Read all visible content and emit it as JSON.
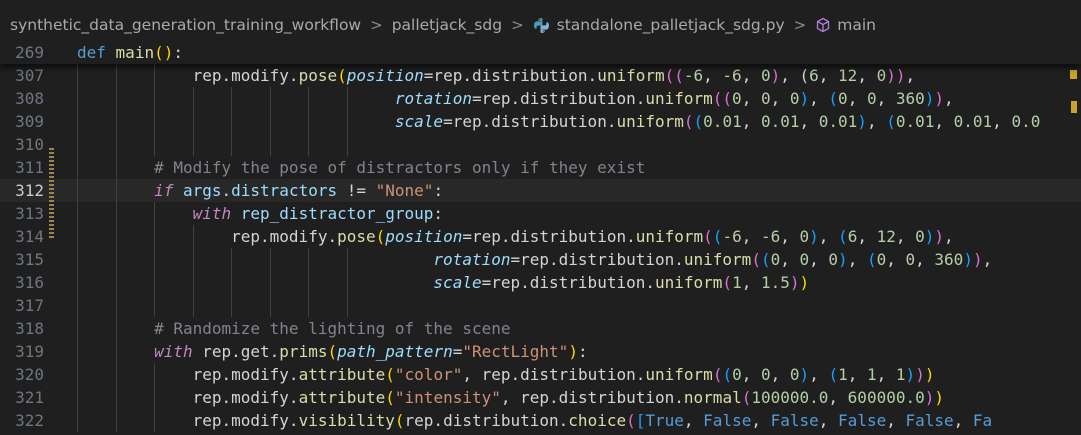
{
  "breadcrumb": {
    "folder": "synthetic_data_generation_training_workflow",
    "subfolder": "palletjack_sdg",
    "file": "standalone_palletjack_sdg.py",
    "symbol": "main",
    "separator": ">"
  },
  "editor": {
    "current_line": "312",
    "lines": [
      {
        "num": "269",
        "tokens": [
          [
            "kw",
            "def"
          ],
          [
            "op",
            " "
          ],
          [
            "fn",
            "main"
          ],
          [
            "p1",
            "("
          ],
          [
            "p1",
            ")"
          ],
          [
            "op",
            ":"
          ]
        ]
      },
      {
        "num": "307",
        "tokens": [
          [
            "op",
            "            rep.modify."
          ],
          [
            "fn",
            "pose"
          ],
          [
            "p1",
            "("
          ],
          [
            "param",
            "position"
          ],
          [
            "op",
            "=rep.distribution."
          ],
          [
            "fn",
            "uniform"
          ],
          [
            "p2",
            "(("
          ],
          [
            "num",
            "-6"
          ],
          [
            "op",
            ", "
          ],
          [
            "num",
            "-6"
          ],
          [
            "op",
            ", "
          ],
          [
            "num",
            "0"
          ],
          [
            "p2",
            ")"
          ],
          [
            "op",
            ", ("
          ],
          [
            "num",
            "6"
          ],
          [
            "op",
            ", "
          ],
          [
            "num",
            "12"
          ],
          [
            "op",
            ", "
          ],
          [
            "num",
            "0"
          ],
          [
            "p2",
            "))"
          ],
          [
            "op",
            ","
          ]
        ]
      },
      {
        "num": "308",
        "tokens": [
          [
            "op",
            "                                 "
          ],
          [
            "param",
            "rotation"
          ],
          [
            "op",
            "=rep.distribution."
          ],
          [
            "fn",
            "uniform"
          ],
          [
            "p2",
            "(("
          ],
          [
            "num",
            "0"
          ],
          [
            "op",
            ", "
          ],
          [
            "num",
            "0"
          ],
          [
            "op",
            ", "
          ],
          [
            "num",
            "0"
          ],
          [
            "p3",
            ")"
          ],
          [
            "op",
            ", "
          ],
          [
            "p3",
            "("
          ],
          [
            "num",
            "0"
          ],
          [
            "op",
            ", "
          ],
          [
            "num",
            "0"
          ],
          [
            "op",
            ", "
          ],
          [
            "num",
            "360"
          ],
          [
            "p3",
            ")"
          ],
          [
            "p2",
            ")"
          ],
          [
            "op",
            ","
          ]
        ]
      },
      {
        "num": "309",
        "tokens": [
          [
            "op",
            "                                 "
          ],
          [
            "param",
            "scale"
          ],
          [
            "op",
            "=rep.distribution."
          ],
          [
            "fn",
            "uniform"
          ],
          [
            "p2",
            "("
          ],
          [
            "p3",
            "("
          ],
          [
            "num",
            "0.01"
          ],
          [
            "op",
            ", "
          ],
          [
            "num",
            "0.01"
          ],
          [
            "op",
            ", "
          ],
          [
            "num",
            "0.01"
          ],
          [
            "p3",
            ")"
          ],
          [
            "op",
            ", "
          ],
          [
            "p3",
            "("
          ],
          [
            "num",
            "0.01"
          ],
          [
            "op",
            ", "
          ],
          [
            "num",
            "0.01"
          ],
          [
            "op",
            ", "
          ],
          [
            "num",
            "0.0"
          ]
        ]
      },
      {
        "num": "310",
        "tokens": []
      },
      {
        "num": "311",
        "tokens": [
          [
            "op",
            "        "
          ],
          [
            "cmt",
            "# Modify the pose of distractors only if they exist"
          ]
        ]
      },
      {
        "num": "312",
        "tokens": [
          [
            "op",
            "        "
          ],
          [
            "ctl",
            "if"
          ],
          [
            "op",
            " "
          ],
          [
            "var",
            "args"
          ],
          [
            "op",
            "."
          ],
          [
            "var",
            "distractors"
          ],
          [
            "op",
            " != "
          ],
          [
            "str",
            "\"None\""
          ],
          [
            "op",
            ":"
          ]
        ]
      },
      {
        "num": "313",
        "tokens": [
          [
            "op",
            "            "
          ],
          [
            "ctl",
            "with"
          ],
          [
            "op",
            " "
          ],
          [
            "var",
            "rep_distractor_group"
          ],
          [
            "op",
            ":"
          ]
        ]
      },
      {
        "num": "314",
        "tokens": [
          [
            "op",
            "                rep.modify."
          ],
          [
            "fn",
            "pose"
          ],
          [
            "p1",
            "("
          ],
          [
            "param",
            "position"
          ],
          [
            "op",
            "=rep.distribution."
          ],
          [
            "fn",
            "uniform"
          ],
          [
            "p2",
            "("
          ],
          [
            "p3",
            "("
          ],
          [
            "num",
            "-6"
          ],
          [
            "op",
            ", "
          ],
          [
            "num",
            "-6"
          ],
          [
            "op",
            ", "
          ],
          [
            "num",
            "0"
          ],
          [
            "p3",
            ")"
          ],
          [
            "op",
            ", "
          ],
          [
            "p3",
            "("
          ],
          [
            "num",
            "6"
          ],
          [
            "op",
            ", "
          ],
          [
            "num",
            "12"
          ],
          [
            "op",
            ", "
          ],
          [
            "num",
            "0"
          ],
          [
            "p3",
            ")"
          ],
          [
            "p2",
            ")"
          ],
          [
            "op",
            ","
          ]
        ]
      },
      {
        "num": "315",
        "tokens": [
          [
            "op",
            "                                     "
          ],
          [
            "param",
            "rotation"
          ],
          [
            "op",
            "=rep.distribution."
          ],
          [
            "fn",
            "uniform"
          ],
          [
            "p2",
            "("
          ],
          [
            "p3",
            "("
          ],
          [
            "num",
            "0"
          ],
          [
            "op",
            ", "
          ],
          [
            "num",
            "0"
          ],
          [
            "op",
            ", "
          ],
          [
            "num",
            "0"
          ],
          [
            "p3",
            ")"
          ],
          [
            "op",
            ", "
          ],
          [
            "p3",
            "("
          ],
          [
            "num",
            "0"
          ],
          [
            "op",
            ", "
          ],
          [
            "num",
            "0"
          ],
          [
            "op",
            ", "
          ],
          [
            "num",
            "360"
          ],
          [
            "p3",
            ")"
          ],
          [
            "p2",
            ")"
          ],
          [
            "op",
            ","
          ]
        ]
      },
      {
        "num": "316",
        "tokens": [
          [
            "op",
            "                                     "
          ],
          [
            "param",
            "scale"
          ],
          [
            "op",
            "=rep.distribution."
          ],
          [
            "fn",
            "uniform"
          ],
          [
            "p2",
            "("
          ],
          [
            "num",
            "1"
          ],
          [
            "op",
            ", "
          ],
          [
            "num",
            "1.5"
          ],
          [
            "p2",
            ")"
          ],
          [
            "p1",
            ")"
          ]
        ]
      },
      {
        "num": "317",
        "tokens": []
      },
      {
        "num": "318",
        "tokens": [
          [
            "op",
            "        "
          ],
          [
            "cmt",
            "# Randomize the lighting of the scene"
          ]
        ]
      },
      {
        "num": "319",
        "tokens": [
          [
            "op",
            "        "
          ],
          [
            "ctl",
            "with"
          ],
          [
            "op",
            " rep.get."
          ],
          [
            "fn",
            "prims"
          ],
          [
            "p1",
            "("
          ],
          [
            "param",
            "path_pattern"
          ],
          [
            "op",
            "="
          ],
          [
            "str",
            "\"RectLight\""
          ],
          [
            "p1",
            ")"
          ],
          [
            "op",
            ":"
          ]
        ]
      },
      {
        "num": "320",
        "tokens": [
          [
            "op",
            "            rep.modify."
          ],
          [
            "fn",
            "attribute"
          ],
          [
            "p1",
            "("
          ],
          [
            "str",
            "\"color\""
          ],
          [
            "op",
            ", rep.distribution."
          ],
          [
            "fn",
            "uniform"
          ],
          [
            "p2",
            "("
          ],
          [
            "p3",
            "("
          ],
          [
            "num",
            "0"
          ],
          [
            "op",
            ", "
          ],
          [
            "num",
            "0"
          ],
          [
            "op",
            ", "
          ],
          [
            "num",
            "0"
          ],
          [
            "p3",
            ")"
          ],
          [
            "op",
            ", "
          ],
          [
            "p3",
            "("
          ],
          [
            "num",
            "1"
          ],
          [
            "op",
            ", "
          ],
          [
            "num",
            "1"
          ],
          [
            "op",
            ", "
          ],
          [
            "num",
            "1"
          ],
          [
            "p3",
            ")"
          ],
          [
            "p2",
            ")"
          ],
          [
            "p1",
            ")"
          ]
        ]
      },
      {
        "num": "321",
        "tokens": [
          [
            "op",
            "            rep.modify."
          ],
          [
            "fn",
            "attribute"
          ],
          [
            "p1",
            "("
          ],
          [
            "str",
            "\"intensity\""
          ],
          [
            "op",
            ", rep.distribution."
          ],
          [
            "fn",
            "normal"
          ],
          [
            "p2",
            "("
          ],
          [
            "num",
            "100000.0"
          ],
          [
            "op",
            ", "
          ],
          [
            "num",
            "600000.0"
          ],
          [
            "p2",
            ")"
          ],
          [
            "p1",
            ")"
          ]
        ]
      },
      {
        "num": "322",
        "tokens": [
          [
            "op",
            "            rep.modify."
          ],
          [
            "fn",
            "visibility"
          ],
          [
            "p1",
            "("
          ],
          [
            "op",
            "rep.distribution."
          ],
          [
            "fn",
            "choice"
          ],
          [
            "p2",
            "("
          ],
          [
            "p3",
            "["
          ],
          [
            "kw",
            "True"
          ],
          [
            "op",
            ", "
          ],
          [
            "kw",
            "False"
          ],
          [
            "op",
            ", "
          ],
          [
            "kw",
            "False"
          ],
          [
            "op",
            ", "
          ],
          [
            "kw",
            "False"
          ],
          [
            "op",
            ", "
          ],
          [
            "kw",
            "False"
          ],
          [
            "op",
            ", "
          ],
          [
            "kw",
            "Fa"
          ]
        ]
      }
    ]
  }
}
